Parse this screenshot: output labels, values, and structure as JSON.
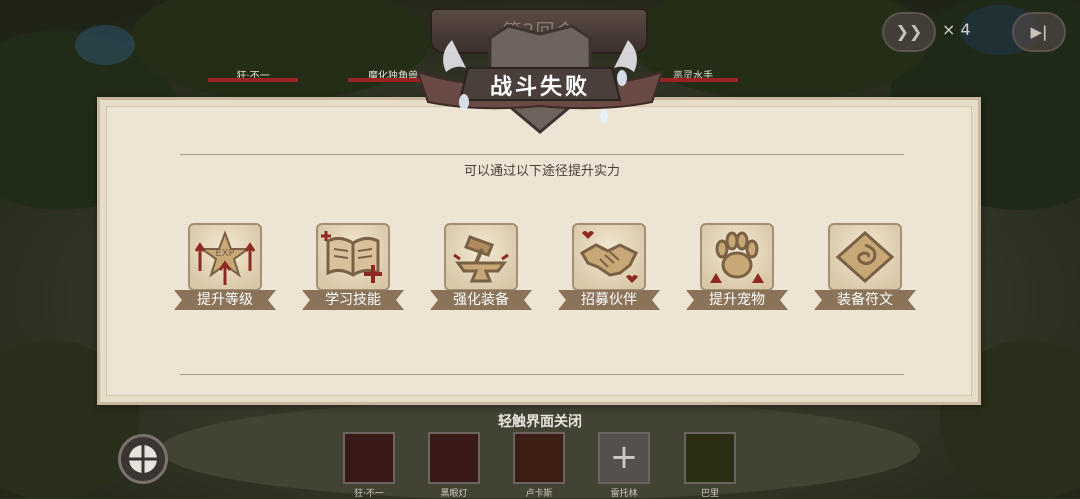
{
  "round_banner": "第2回合",
  "result": {
    "title": "战斗失败"
  },
  "enemies": [
    {
      "name": "狂·不一"
    },
    {
      "name": "魔化独角兽"
    },
    {
      "name": "恶灵水手"
    }
  ],
  "speed": {
    "label": "× 4"
  },
  "panel": {
    "subtitle": "可以通过以下途径提升实力",
    "options": [
      {
        "label": "提升等级",
        "icon": "level-up-exp-icon"
      },
      {
        "label": "学习技能",
        "icon": "skill-book-icon"
      },
      {
        "label": "强化装备",
        "icon": "forge-anvil-icon"
      },
      {
        "label": "招募伙伴",
        "icon": "handshake-icon"
      },
      {
        "label": "提升宠物",
        "icon": "paw-icon"
      },
      {
        "label": "装备符文",
        "icon": "rune-icon"
      }
    ]
  },
  "footer": {
    "tap_to_close": "轻触界面关闭",
    "heroes": [
      {
        "name": "狂·不一"
      },
      {
        "name": "黑眼灯"
      },
      {
        "name": "卢卡斯"
      },
      {
        "name": "雷托林"
      },
      {
        "name": "巴里"
      }
    ],
    "add_slot_icon": "plus-icon"
  },
  "colors": {
    "panel_bg": "#ede4d4",
    "ribbon": "#8a7358",
    "icon_brown": "#7a6146",
    "accent_red": "#8c2a22"
  }
}
